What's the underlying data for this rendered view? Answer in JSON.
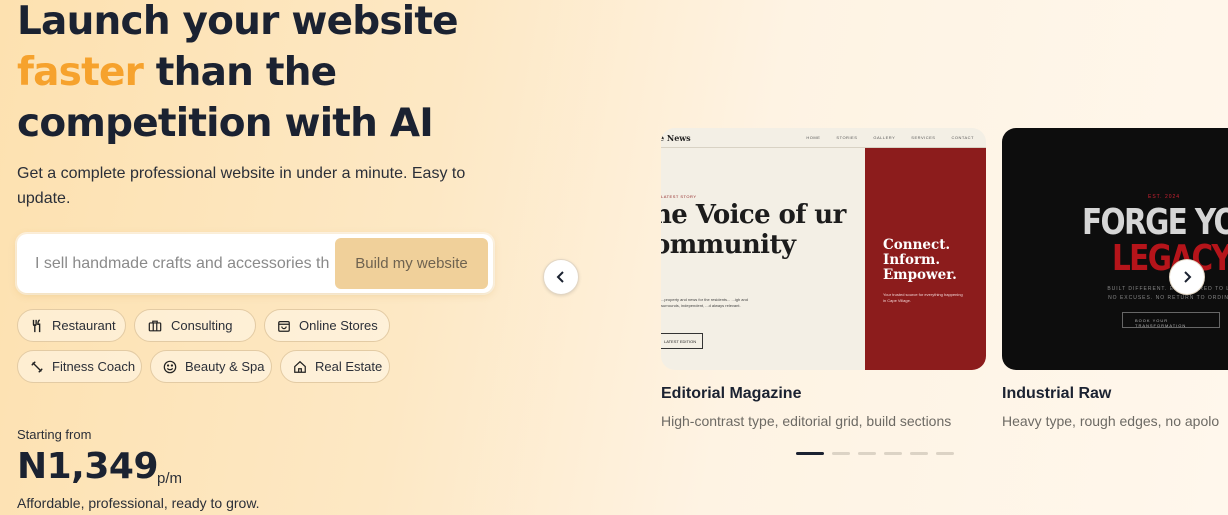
{
  "hero": {
    "title_line1": "Launch your website",
    "title_accent": "faster",
    "title_line2_rest": " than the",
    "title_line3": "competition with AI",
    "subtitle": "Get a complete professional website in under a minute. Easy to update."
  },
  "search": {
    "placeholder": "I sell handmade crafts and accessories th",
    "button_label": "Build my website"
  },
  "categories": [
    {
      "label": "Restaurant",
      "icon": "utensils-icon"
    },
    {
      "label": "Consulting",
      "icon": "briefcase-icon"
    },
    {
      "label": "Online Stores",
      "icon": "shopping-bag-icon"
    },
    {
      "label": "Fitness Coach",
      "icon": "dumbbell-icon"
    },
    {
      "label": "Beauty & Spa",
      "icon": "smile-icon"
    },
    {
      "label": "Real Estate",
      "icon": "house-icon"
    }
  ],
  "pricing": {
    "label": "Starting from",
    "amount": "N1,349",
    "unit": "p/m",
    "note": "Affordable, professional, ready to grow."
  },
  "carousel": {
    "prev_icon": "chevron-left-icon",
    "next_icon": "chevron-right-icon",
    "active_index": 0,
    "dot_count": 6,
    "cards": [
      {
        "title": "Editorial Magazine",
        "description": "High-contrast type, editorial grid, build sections",
        "preview": {
          "brand": "e News",
          "nav": [
            "HOME",
            "STORIES",
            "GALLERY",
            "SERVICES",
            "CONTACT"
          ],
          "kicker": "LATEST STORY",
          "headline": "he Voice of ur ommunity",
          "body": "...property and news for the residents... ...igh and surrounds, independent, ...d always relevant.",
          "button": "LATEST EDITION",
          "side_headline": "Connect. Inform. Empower.",
          "side_body": "Your trusted source for everything happening in Cape Village."
        }
      },
      {
        "title": "Industrial Raw",
        "description": "Heavy type, rough edges, no apolo",
        "preview": {
          "kicker": "EST. 2024",
          "headline_1": "FORGE YO",
          "headline_2": "LEGACY",
          "sub": "BUILT DIFFERENT. ENGINEERED TO LAST. NO EXCUSES. NO RETURN TO ORDINARY.",
          "button": "BOOK YOUR TRANSFORMATION"
        }
      }
    ]
  },
  "colors": {
    "accent": "#f6a22d",
    "heading": "#1b2231",
    "build_button_bg": "#f0d09a",
    "editorial_red": "#8c1c1c",
    "industrial_red": "#b5141a"
  }
}
